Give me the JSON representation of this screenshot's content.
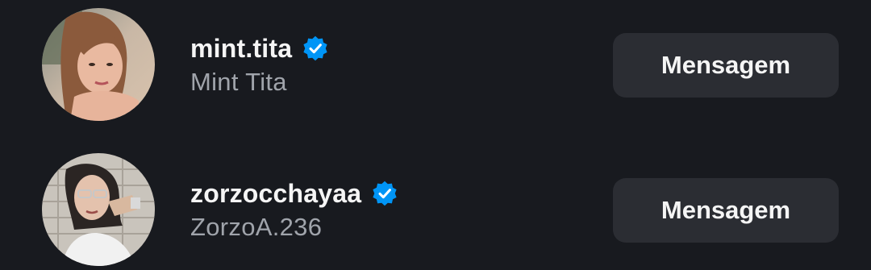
{
  "accent": "#0095f6",
  "users": [
    {
      "username": "mint.tita",
      "full_name": "Mint Tita",
      "verified": true,
      "message_label": "Mensagem",
      "avatar_icon": "profile-photo"
    },
    {
      "username": "zorzocchayaa",
      "full_name": "ZorzoA.236",
      "verified": true,
      "message_label": "Mensagem",
      "avatar_icon": "profile-photo"
    }
  ]
}
